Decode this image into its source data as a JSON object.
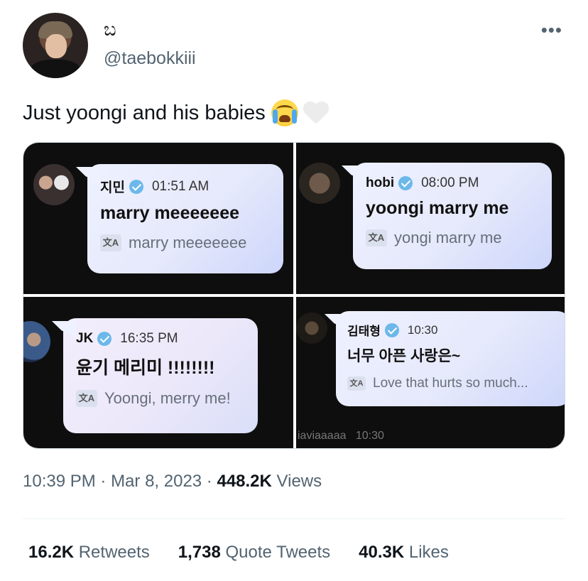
{
  "author": {
    "display_name": "ಬ",
    "handle": "@taebokkiii"
  },
  "tweet": {
    "text": "Just yoongi and his babies",
    "emoji": [
      "loudly-crying-face",
      "white-heart"
    ]
  },
  "media": {
    "panels": [
      {
        "name": "지민",
        "time": "01:51 AM",
        "message": "marry meeeeeee",
        "translation": "marry meeeeeee"
      },
      {
        "name": "hobi",
        "time": "08:00 PM",
        "message": "yoongi marry me",
        "translation": "yongi marry me"
      },
      {
        "name": "JK",
        "time": "16:35 PM",
        "message": "윤기 메리미 !!!!!!!!",
        "translation": "Yoongi, merry me!"
      },
      {
        "name": "김태형",
        "time": "10:30",
        "message": "너무 아픈 사랑은~",
        "translation": "Love that hurts so much..."
      }
    ],
    "footer_name": "iaviaaaaa",
    "footer_time": "10:30"
  },
  "meta": {
    "time": "10:39 PM",
    "date": "Mar 8, 2023",
    "views_count": "448.2K",
    "views_label": "Views"
  },
  "stats": {
    "retweets_count": "16.2K",
    "retweets_label": "Retweets",
    "quotes_count": "1,738",
    "quotes_label": "Quote Tweets",
    "likes_count": "40.3K",
    "likes_label": "Likes"
  },
  "colors": {
    "text": "#0f1419",
    "secondary": "#536471",
    "verified": "#6cb8ea",
    "bubble_start": "#eef1ff",
    "bubble_end": "#cdd6fb",
    "panel_bg": "#0e0e0e"
  }
}
